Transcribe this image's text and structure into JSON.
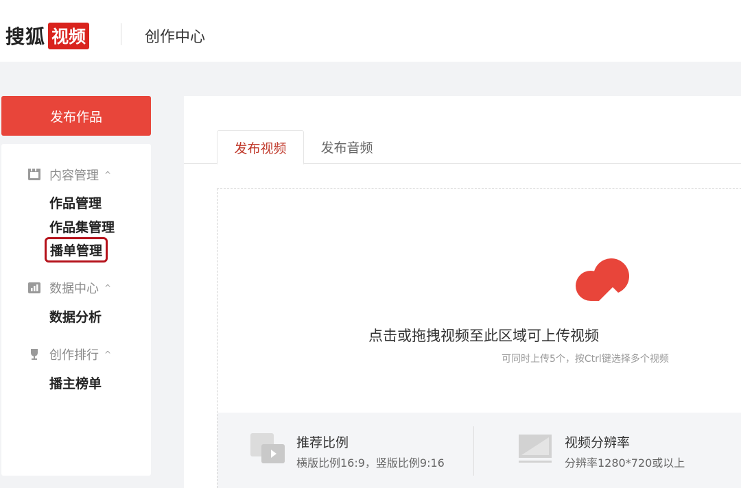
{
  "header": {
    "logo_text": "搜狐",
    "logo_badge": "视频",
    "title": "创作中心"
  },
  "sidebar": {
    "publish_button": "发布作品",
    "sections": [
      {
        "label": "内容管理",
        "icon": "film-icon",
        "items": [
          "作品管理",
          "作品集管理",
          "播单管理"
        ]
      },
      {
        "label": "数据中心",
        "icon": "bar-chart-icon",
        "items": [
          "数据分析"
        ]
      },
      {
        "label": "创作排行",
        "icon": "trophy-icon",
        "items": [
          "播主榜单"
        ]
      }
    ],
    "highlighted_item": "播单管理"
  },
  "main": {
    "tabs": [
      {
        "label": "发布视频",
        "active": true
      },
      {
        "label": "发布音频",
        "active": false
      }
    ],
    "upload": {
      "icon": "upload-cloud-icon",
      "main_text": "点击或拖拽视频至此区域可上传视频",
      "sub_text": "可同时上传5个，按Ctrl键选择多个视频"
    },
    "tips": [
      {
        "icon": "aspect-ratio-icon",
        "title": "推荐比例",
        "desc": "横版比例16:9，竖版比例9:16"
      },
      {
        "icon": "resolution-icon",
        "title": "视频分辨率",
        "desc": "分辨率1280*720或以上"
      }
    ]
  },
  "colors": {
    "accent": "#e8453a",
    "logo_red": "#d9231d",
    "highlight_border": "#b5121b",
    "active_tab_text": "#c0392b"
  }
}
